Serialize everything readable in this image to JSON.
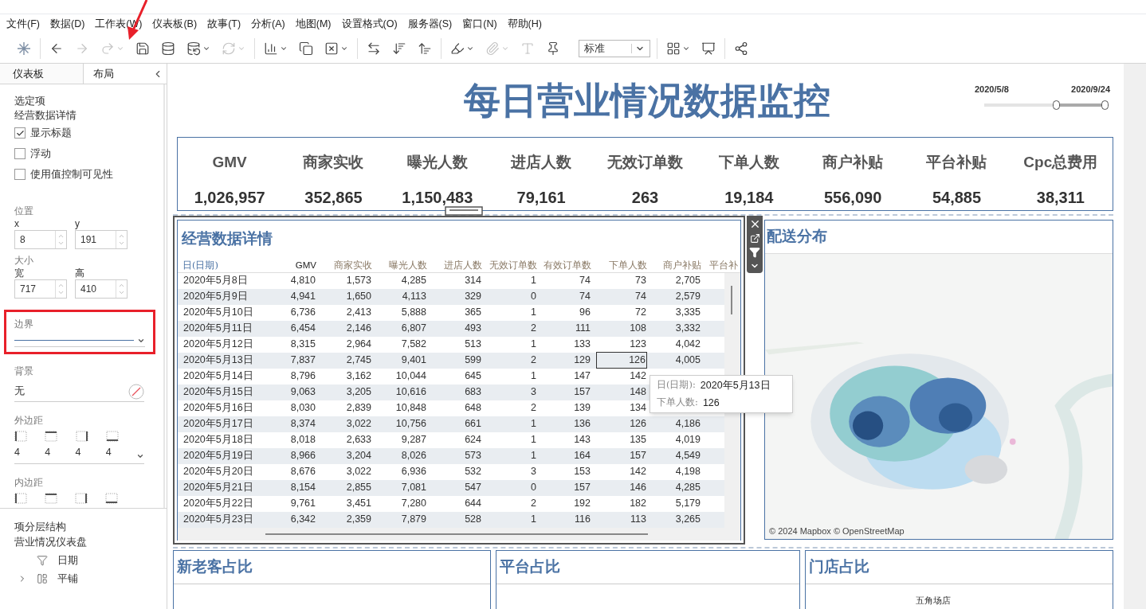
{
  "menu": [
    "文件(F)",
    "数据(D)",
    "工作表(W)",
    "仪表板(B)",
    "故事(T)",
    "分析(A)",
    "地图(M)",
    "设置格式(O)",
    "服务器(S)",
    "窗口(N)",
    "帮助(H)"
  ],
  "toolbar": [
    [
      {
        "kind": "logo",
        "disabled": false,
        "caret": false
      }
    ],
    [
      {
        "kind": "back",
        "disabled": false,
        "caret": false
      },
      {
        "kind": "forward",
        "disabled": true,
        "caret": false
      },
      {
        "kind": "redo",
        "disabled": true,
        "caret": true
      },
      {
        "kind": "save",
        "disabled": false,
        "caret": false
      },
      {
        "kind": "datasource",
        "disabled": false,
        "caret": false
      },
      {
        "kind": "pause",
        "disabled": false,
        "caret": true
      },
      {
        "kind": "refresh",
        "disabled": true,
        "caret": true
      }
    ],
    [
      {
        "kind": "newsheet",
        "disabled": false,
        "caret": true
      },
      {
        "kind": "duplicate",
        "disabled": false,
        "caret": false
      },
      {
        "kind": "clear",
        "disabled": false,
        "caret": true
      }
    ],
    [
      {
        "kind": "swap",
        "disabled": false,
        "caret": false
      },
      {
        "kind": "sortasc",
        "disabled": false,
        "caret": false
      },
      {
        "kind": "sortdesc",
        "disabled": false,
        "caret": false
      }
    ],
    [
      {
        "kind": "highlight",
        "disabled": false,
        "caret": true
      },
      {
        "kind": "clip",
        "disabled": true,
        "caret": true
      },
      {
        "kind": "text",
        "disabled": true,
        "caret": false
      },
      {
        "kind": "pin",
        "disabled": false,
        "caret": false
      },
      {
        "kind": "select",
        "value": "标准"
      }
    ],
    [
      {
        "kind": "chart",
        "disabled": false,
        "caret": true
      },
      {
        "kind": "present",
        "disabled": false,
        "caret": false
      }
    ],
    [
      {
        "kind": "share",
        "disabled": false,
        "caret": false
      }
    ]
  ],
  "annotations": [
    {
      "kind": "arrow"
    }
  ],
  "left_panel": {
    "tabs": [
      {
        "label": "仪表板",
        "selected": false
      },
      {
        "label": "布局",
        "selected": true
      }
    ],
    "selected_heading": "选定项",
    "selected_name": "经营数据详情",
    "options": [
      {
        "label": "显示标题",
        "checked": true
      },
      {
        "label": "浮动",
        "checked": false
      },
      {
        "label": "使用值控制可见性",
        "checked": false
      }
    ],
    "position": {
      "label": "位置",
      "fields": [
        {
          "label": "x",
          "value": "8"
        },
        {
          "label": "y",
          "value": "191"
        }
      ]
    },
    "size": {
      "label": "大小",
      "fields": [
        {
          "label": "宽",
          "value": "717"
        },
        {
          "label": "高",
          "value": "410"
        }
      ]
    },
    "border": {
      "label": "边界",
      "highlighted": true
    },
    "background": {
      "label": "背景",
      "value": "无"
    },
    "outer_padding": {
      "label": "外边距",
      "values": [
        "4",
        "4",
        "4",
        "4"
      ]
    },
    "inner_padding": {
      "label": "内边距"
    },
    "hierarchy": {
      "title": "项分层结构",
      "root": "营业情况仪表盘",
      "children": [
        {
          "kind": "filter",
          "label": "日期",
          "has_children": false
        },
        {
          "kind": "tiled",
          "label": "平铺",
          "expanded": false,
          "has_children": true
        }
      ]
    }
  },
  "dashboard": {
    "title": "每日营业情况数据监控",
    "date_filter": {
      "start": "2020/5/8",
      "end": "2020/9/24",
      "handles": [
        {
          "level": 0.6
        },
        {
          "level": 1
        }
      ]
    },
    "kpis": [
      {
        "label": "GMV",
        "value": "1,026,957"
      },
      {
        "label": "商家实收",
        "value": "352,865"
      },
      {
        "label": "曝光人数",
        "value": "1,150,483"
      },
      {
        "label": "进店人数",
        "value": "79,161"
      },
      {
        "label": "无效订单数",
        "value": "263"
      },
      {
        "label": "下单人数",
        "value": "19,184"
      },
      {
        "label": "商户补贴",
        "value": "556,090"
      },
      {
        "label": "平台补贴",
        "value": "54,885"
      },
      {
        "label": "Cpc总费用",
        "value": "38,311"
      }
    ],
    "table": {
      "title": "经营数据详情",
      "selected": true,
      "columns": [
        "日(日期)",
        "GMV",
        "商家实收",
        "曝光人数",
        "进店人数",
        "无效订单数",
        "有效订单数",
        "下单人数",
        "商户补贴",
        "平台补"
      ],
      "rows": [
        {
          "cells": [
            {
              "text": "2020年5月8日",
              "selected": false
            },
            {
              "text": "4,810",
              "selected": false
            },
            {
              "text": "1,573",
              "selected": false
            },
            {
              "text": "4,285",
              "selected": false
            },
            {
              "text": "314",
              "selected": false
            },
            {
              "text": "1",
              "selected": false
            },
            {
              "text": "74",
              "selected": false
            },
            {
              "text": "73",
              "selected": false
            },
            {
              "text": "2,705",
              "selected": false
            }
          ]
        },
        {
          "cells": [
            {
              "text": "2020年5月9日",
              "selected": false
            },
            {
              "text": "4,941",
              "selected": false
            },
            {
              "text": "1,650",
              "selected": false
            },
            {
              "text": "4,113",
              "selected": false
            },
            {
              "text": "329",
              "selected": false
            },
            {
              "text": "0",
              "selected": false
            },
            {
              "text": "74",
              "selected": false
            },
            {
              "text": "74",
              "selected": false
            },
            {
              "text": "2,579",
              "selected": false
            }
          ]
        },
        {
          "cells": [
            {
              "text": "2020年5月10日",
              "selected": false
            },
            {
              "text": "6,736",
              "selected": false
            },
            {
              "text": "2,413",
              "selected": false
            },
            {
              "text": "5,888",
              "selected": false
            },
            {
              "text": "365",
              "selected": false
            },
            {
              "text": "1",
              "selected": false
            },
            {
              "text": "96",
              "selected": false
            },
            {
              "text": "72",
              "selected": false
            },
            {
              "text": "3,335",
              "selected": false
            }
          ]
        },
        {
          "cells": [
            {
              "text": "2020年5月11日",
              "selected": false
            },
            {
              "text": "6,454",
              "selected": false
            },
            {
              "text": "2,146",
              "selected": false
            },
            {
              "text": "6,807",
              "selected": false
            },
            {
              "text": "493",
              "selected": false
            },
            {
              "text": "2",
              "selected": false
            },
            {
              "text": "111",
              "selected": false
            },
            {
              "text": "108",
              "selected": false
            },
            {
              "text": "3,332",
              "selected": false
            }
          ]
        },
        {
          "cells": [
            {
              "text": "2020年5月12日",
              "selected": false
            },
            {
              "text": "8,315",
              "selected": false
            },
            {
              "text": "2,964",
              "selected": false
            },
            {
              "text": "7,582",
              "selected": false
            },
            {
              "text": "513",
              "selected": false
            },
            {
              "text": "1",
              "selected": false
            },
            {
              "text": "133",
              "selected": false
            },
            {
              "text": "123",
              "selected": false
            },
            {
              "text": "4,042",
              "selected": false
            }
          ]
        },
        {
          "cells": [
            {
              "text": "2020年5月13日",
              "selected": false
            },
            {
              "text": "7,837",
              "selected": false
            },
            {
              "text": "2,745",
              "selected": false
            },
            {
              "text": "9,401",
              "selected": false
            },
            {
              "text": "599",
              "selected": false
            },
            {
              "text": "2",
              "selected": false
            },
            {
              "text": "129",
              "selected": false
            },
            {
              "text": "126",
              "selected": true
            },
            {
              "text": "4,005",
              "selected": false
            }
          ]
        },
        {
          "cells": [
            {
              "text": "2020年5月14日",
              "selected": false
            },
            {
              "text": "8,796",
              "selected": false
            },
            {
              "text": "3,162",
              "selected": false
            },
            {
              "text": "10,044",
              "selected": false
            },
            {
              "text": "645",
              "selected": false
            },
            {
              "text": "1",
              "selected": false
            },
            {
              "text": "147",
              "selected": false
            },
            {
              "text": "142",
              "selected": false
            }
          ]
        },
        {
          "cells": [
            {
              "text": "2020年5月15日",
              "selected": false
            },
            {
              "text": "9,063",
              "selected": false
            },
            {
              "text": "3,205",
              "selected": false
            },
            {
              "text": "10,616",
              "selected": false
            },
            {
              "text": "683",
              "selected": false
            },
            {
              "text": "3",
              "selected": false
            },
            {
              "text": "157",
              "selected": false
            },
            {
              "text": "148",
              "selected": false
            }
          ]
        },
        {
          "cells": [
            {
              "text": "2020年5月16日",
              "selected": false
            },
            {
              "text": "8,030",
              "selected": false
            },
            {
              "text": "2,839",
              "selected": false
            },
            {
              "text": "10,848",
              "selected": false
            },
            {
              "text": "648",
              "selected": false
            },
            {
              "text": "2",
              "selected": false
            },
            {
              "text": "139",
              "selected": false
            },
            {
              "text": "134",
              "selected": false
            }
          ]
        },
        {
          "cells": [
            {
              "text": "2020年5月17日",
              "selected": false
            },
            {
              "text": "8,374",
              "selected": false
            },
            {
              "text": "3,022",
              "selected": false
            },
            {
              "text": "10,756",
              "selected": false
            },
            {
              "text": "661",
              "selected": false
            },
            {
              "text": "1",
              "selected": false
            },
            {
              "text": "136",
              "selected": false
            },
            {
              "text": "126",
              "selected": false
            },
            {
              "text": "4,186",
              "selected": false
            }
          ]
        },
        {
          "cells": [
            {
              "text": "2020年5月18日",
              "selected": false
            },
            {
              "text": "8,018",
              "selected": false
            },
            {
              "text": "2,633",
              "selected": false
            },
            {
              "text": "9,287",
              "selected": false
            },
            {
              "text": "624",
              "selected": false
            },
            {
              "text": "1",
              "selected": false
            },
            {
              "text": "143",
              "selected": false
            },
            {
              "text": "135",
              "selected": false
            },
            {
              "text": "4,019",
              "selected": false
            }
          ]
        },
        {
          "cells": [
            {
              "text": "2020年5月19日",
              "selected": false
            },
            {
              "text": "8,966",
              "selected": false
            },
            {
              "text": "3,204",
              "selected": false
            },
            {
              "text": "8,026",
              "selected": false
            },
            {
              "text": "573",
              "selected": false
            },
            {
              "text": "1",
              "selected": false
            },
            {
              "text": "164",
              "selected": false
            },
            {
              "text": "157",
              "selected": false
            },
            {
              "text": "4,549",
              "selected": false
            }
          ]
        },
        {
          "cells": [
            {
              "text": "2020年5月20日",
              "selected": false
            },
            {
              "text": "8,676",
              "selected": false
            },
            {
              "text": "3,022",
              "selected": false
            },
            {
              "text": "6,936",
              "selected": false
            },
            {
              "text": "532",
              "selected": false
            },
            {
              "text": "3",
              "selected": false
            },
            {
              "text": "153",
              "selected": false
            },
            {
              "text": "142",
              "selected": false
            },
            {
              "text": "4,198",
              "selected": false
            }
          ]
        },
        {
          "cells": [
            {
              "text": "2020年5月21日",
              "selected": false
            },
            {
              "text": "8,154",
              "selected": false
            },
            {
              "text": "2,855",
              "selected": false
            },
            {
              "text": "7,081",
              "selected": false
            },
            {
              "text": "547",
              "selected": false
            },
            {
              "text": "0",
              "selected": false
            },
            {
              "text": "157",
              "selected": false
            },
            {
              "text": "146",
              "selected": false
            },
            {
              "text": "4,285",
              "selected": false
            }
          ]
        },
        {
          "cells": [
            {
              "text": "2020年5月22日",
              "selected": false
            },
            {
              "text": "9,761",
              "selected": false
            },
            {
              "text": "3,451",
              "selected": false
            },
            {
              "text": "7,280",
              "selected": false
            },
            {
              "text": "644",
              "selected": false
            },
            {
              "text": "2",
              "selected": false
            },
            {
              "text": "192",
              "selected": false
            },
            {
              "text": "182",
              "selected": false
            },
            {
              "text": "5,179",
              "selected": false
            }
          ]
        },
        {
          "cells": [
            {
              "text": "2020年5月23日",
              "selected": false
            },
            {
              "text": "6,342",
              "selected": false
            },
            {
              "text": "2,359",
              "selected": false
            },
            {
              "text": "7,879",
              "selected": false
            },
            {
              "text": "528",
              "selected": false
            },
            {
              "text": "1",
              "selected": false
            },
            {
              "text": "116",
              "selected": false
            },
            {
              "text": "113",
              "selected": false
            },
            {
              "text": "3,265",
              "selected": false
            }
          ]
        }
      ],
      "tooltip": [
        {
          "label": "日(日期):",
          "value": "2020年5月13日"
        },
        {
          "label": "下单人数:",
          "value": "126"
        }
      ]
    },
    "map": {
      "title": "配送分布",
      "attribution": "© 2024 Mapbox © OpenStreetMap"
    },
    "bottom_panels": [
      {
        "title": "新老客占比"
      },
      {
        "title": "平台占比"
      },
      {
        "title": "门店占比",
        "label": "五角场店"
      }
    ]
  }
}
